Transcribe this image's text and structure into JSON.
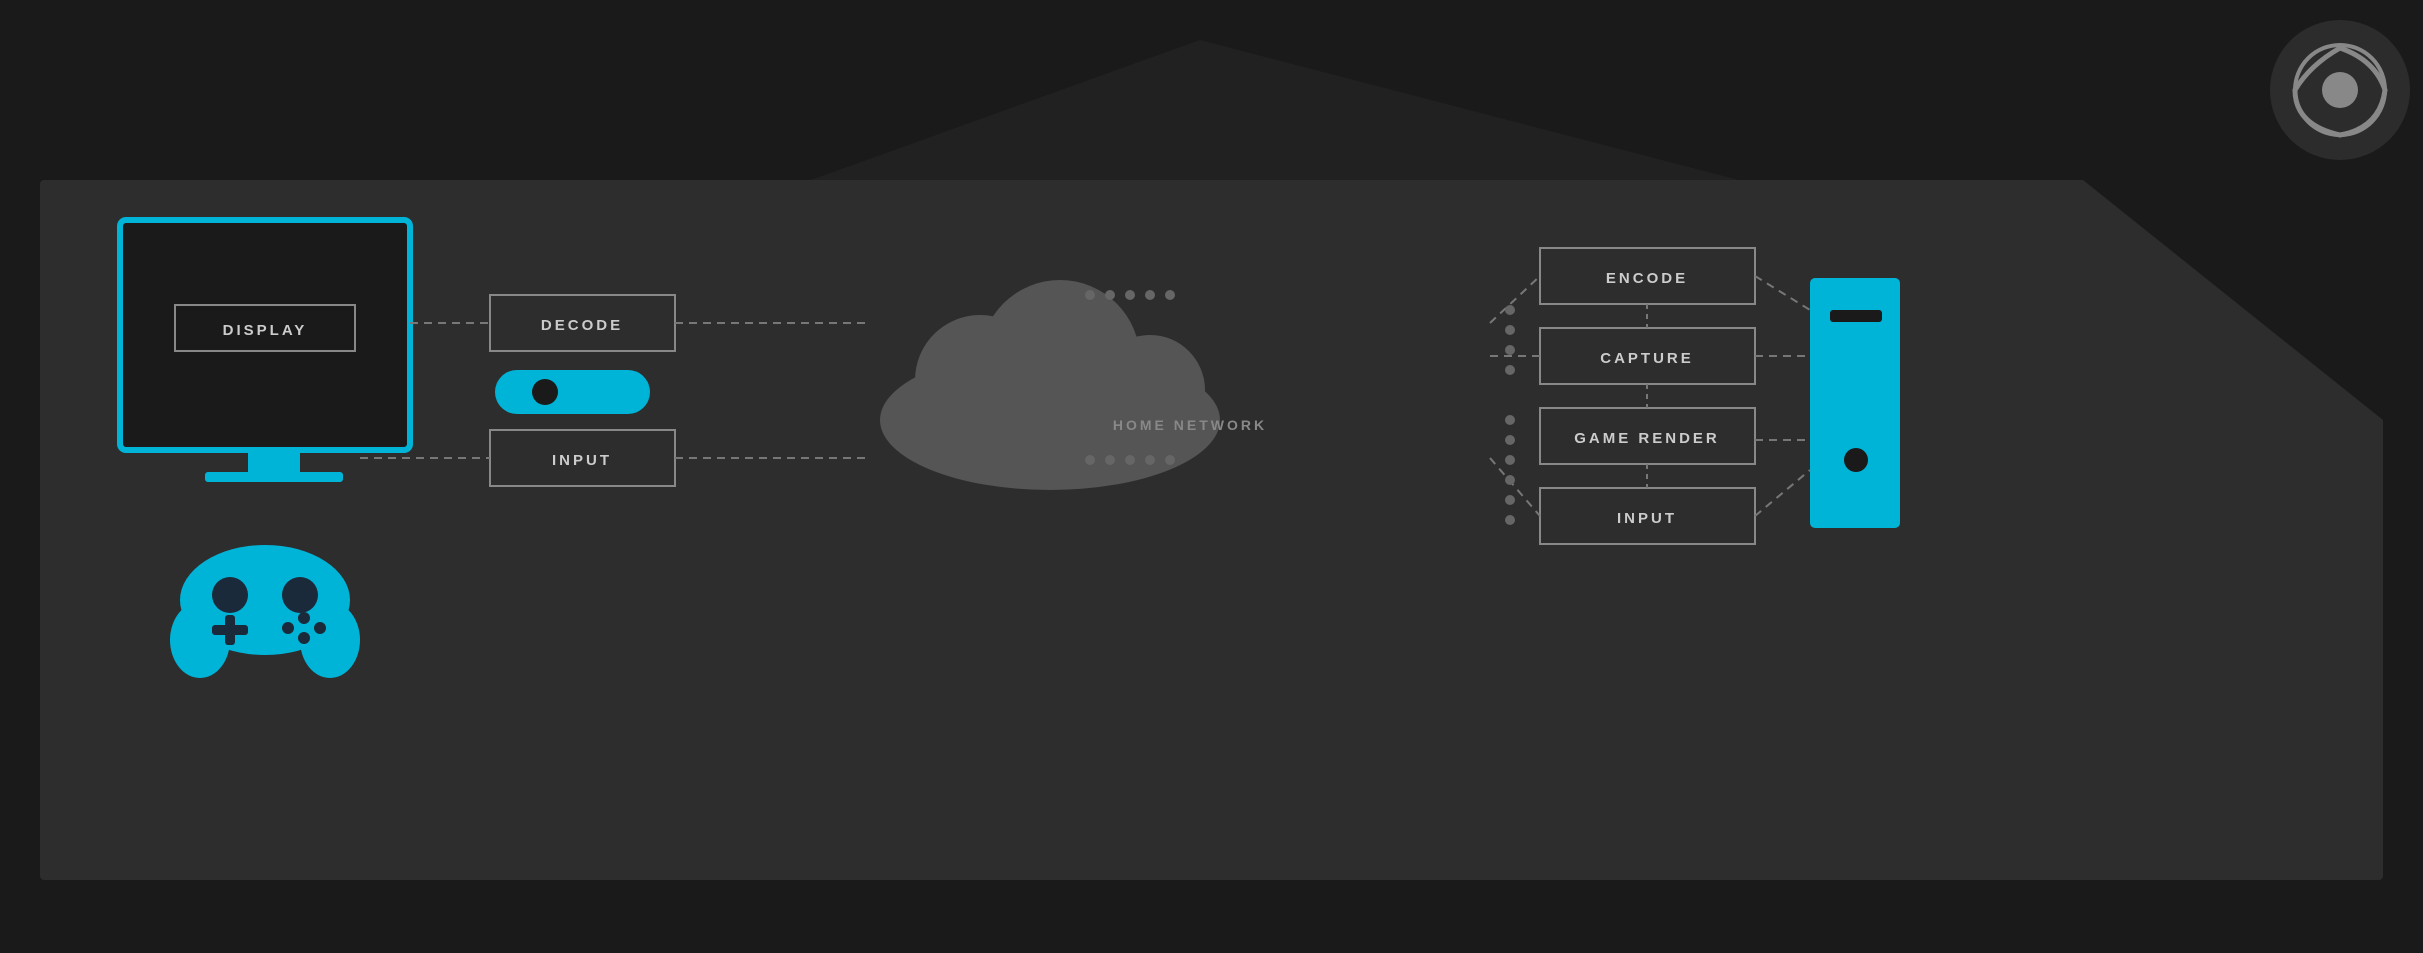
{
  "background": {
    "color": "#1a1a1a",
    "panel_color": "#2a2a2a"
  },
  "steam_logo": {
    "label": "Steam Logo"
  },
  "left": {
    "tv_label": "DISPLAY",
    "gamepad_label": "Gamepad icon"
  },
  "middle_left": {
    "decode_label": "DECODE",
    "input_label": "INPUT",
    "controller_label": "Steam controller"
  },
  "cloud": {
    "label": "HOME NETWORK"
  },
  "right": {
    "encode_label": "ENCODE",
    "capture_label": "CAPTURE",
    "game_render_label": "GAME RENDER",
    "input_label": "INPUT"
  },
  "pc_tower": {
    "label": "PC Tower"
  }
}
